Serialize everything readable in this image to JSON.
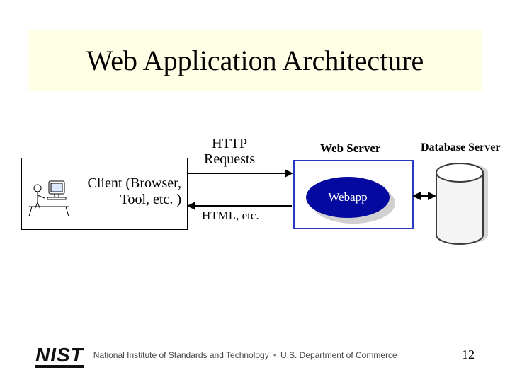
{
  "title": "Web Application Architecture",
  "client": {
    "label_line1": "Client (Browser,",
    "label_line2": "Tool, etc. )"
  },
  "labels": {
    "request_line1": "HTTP",
    "request_line2": "Requests",
    "response": "HTML, etc.",
    "web_server": "Web Server",
    "db_server": "Database Server",
    "webapp": "Webapp"
  },
  "footer": {
    "logo_text": "NIST",
    "org": "National Institute of Standards and Technology",
    "dept": "U.S. Department of Commerce"
  },
  "page_number": "12"
}
